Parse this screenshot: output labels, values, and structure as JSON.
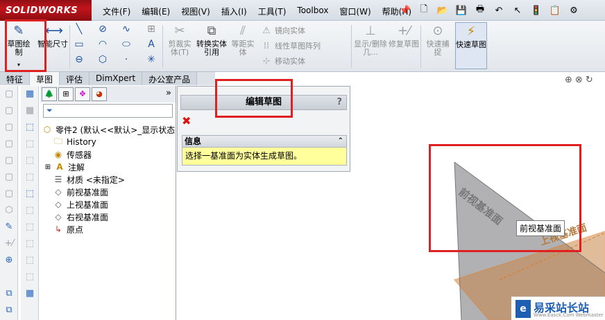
{
  "app": {
    "logo_text": "SOLIDWORKS",
    "menus": [
      "文件(F)",
      "编辑(E)",
      "视图(V)",
      "插入(I)",
      "工具(T)",
      "Toolbox",
      "窗口(W)",
      "帮助(H)"
    ]
  },
  "ribbon": {
    "sketch_label": "草图绘制",
    "smart_dim_label": "智能尺寸",
    "trim_label": "剪裁实体(T)",
    "convert_label": "转换实体引用",
    "offset_label": "等距实体",
    "mirror_label": "镜向实体",
    "linear_pattern_label": "线性草图阵列",
    "move_label": "移动实体",
    "showhide_label": "显示/删除几...",
    "repair_label": "修复草图",
    "quick_snap_label": "快速捕捉",
    "rapid_sketch_label": "快速草图"
  },
  "tabs": [
    "特征",
    "草图",
    "评估",
    "DimXpert",
    "办公室产品"
  ],
  "feature_tree": {
    "root": "零件2 (默认<<默认>_显示状态",
    "items": [
      "History",
      "传感器",
      "注解",
      "材质 <未指定>",
      "前视基准面",
      "上视基准面",
      "右视基准面",
      "原点"
    ]
  },
  "property_manager": {
    "title": "编辑草图",
    "help": "?",
    "info_title": "信息",
    "info_text": "选择一基准面为实体生成草图。"
  },
  "viewport": {
    "plane_label_front": "前视基准面",
    "plane_label_top": "上视基准面",
    "tooltip": "前视基准面"
  },
  "watermark": {
    "text": "易采站长站",
    "sub": "Www.Easck.Com Webmaster"
  }
}
